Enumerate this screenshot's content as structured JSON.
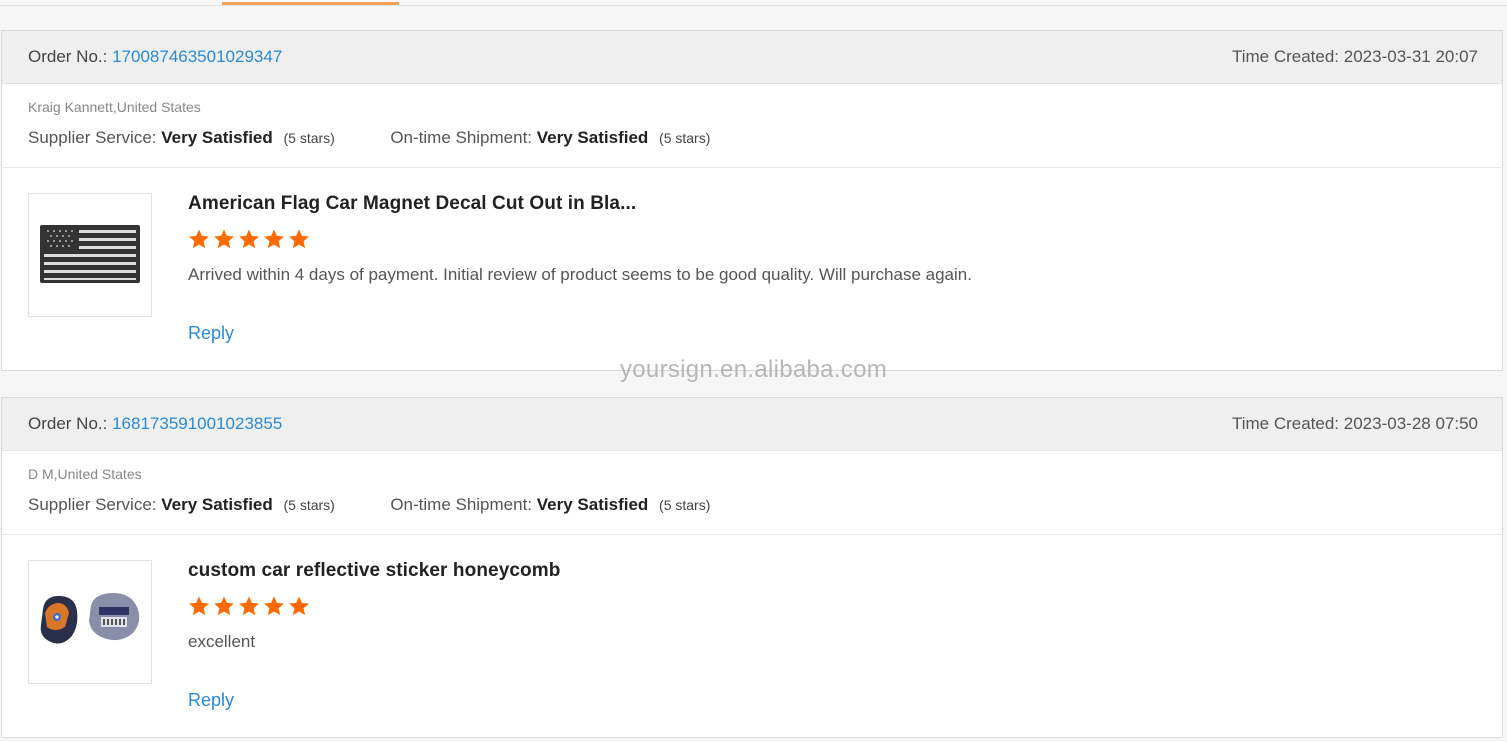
{
  "labels": {
    "order_no": "Order No.:",
    "time_created": "Time Created:",
    "supplier_service": "Supplier Service:",
    "ontime_shipment": "On-time Shipment:",
    "reply": "Reply"
  },
  "watermark": "yoursign.en.alibaba.com",
  "reviews": [
    {
      "order_no": "170087463501029347",
      "time_created": "2023-03-31 20:07",
      "buyer": "Kraig Kannett,United States",
      "supplier_service": "Very Satisfied",
      "supplier_service_stars": "(5 stars)",
      "ontime_shipment": "Very Satisfied",
      "ontime_shipment_stars": "(5 stars)",
      "product_title": "American Flag Car Magnet Decal Cut Out in Bla...",
      "rating": 5,
      "review_text": "Arrived within 4 days of payment. Initial review of product seems to be good quality. Will purchase again.",
      "thumbnail": "american-flag-decal"
    },
    {
      "order_no": "168173591001023855",
      "time_created": "2023-03-28 07:50",
      "buyer": "D M,United States",
      "supplier_service": "Very Satisfied",
      "supplier_service_stars": "(5 stars)",
      "ontime_shipment": "Very Satisfied",
      "ontime_shipment_stars": "(5 stars)",
      "product_title": "custom car reflective sticker honeycomb",
      "rating": 5,
      "review_text": "excellent",
      "thumbnail": "reflective-sticker"
    }
  ],
  "colors": {
    "link": "#2b8ad6",
    "star": "#ff6a00",
    "header_bg": "#efefef",
    "active_tab": "#f0a25a"
  }
}
